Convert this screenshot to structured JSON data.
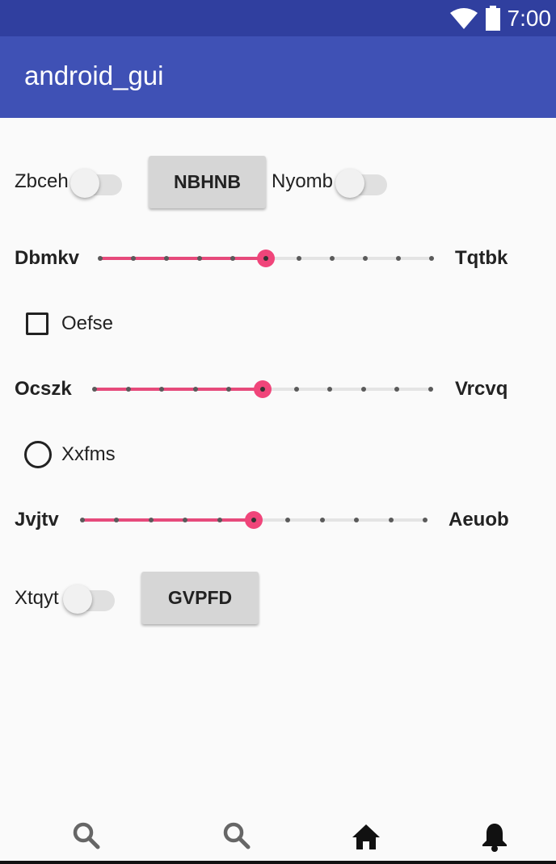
{
  "status_bar": {
    "time": "7:00",
    "icons": [
      "wifi-icon",
      "battery-icon"
    ]
  },
  "app_bar": {
    "title": "android_gui"
  },
  "row1": {
    "switch1_label": "Zbceh",
    "button_label": "NBHNB",
    "switch2_label": "Nyomb"
  },
  "slider1": {
    "left_label": "Dbmkv",
    "right_label": "Tqtbk",
    "ticks": 10,
    "value": 5
  },
  "checkbox": {
    "label": "Oefse",
    "checked": false
  },
  "slider2": {
    "left_label": "Ocszk",
    "right_label": "Vrcvq",
    "ticks": 10,
    "value": 5
  },
  "radio": {
    "label": "Xxfms",
    "checked": false
  },
  "slider3": {
    "left_label": "Jvjtv",
    "right_label": "Aeuob",
    "ticks": 10,
    "value": 5
  },
  "row2": {
    "switch_label": "Xtqyt",
    "button_label": "GVPFD"
  },
  "bottom_nav": {
    "items": [
      "search-icon",
      "search-icon",
      "home-icon",
      "bell-icon"
    ]
  },
  "colors": {
    "primary": "#3f51b5",
    "primary_dark": "#303f9f",
    "accent": "#f0457a"
  }
}
